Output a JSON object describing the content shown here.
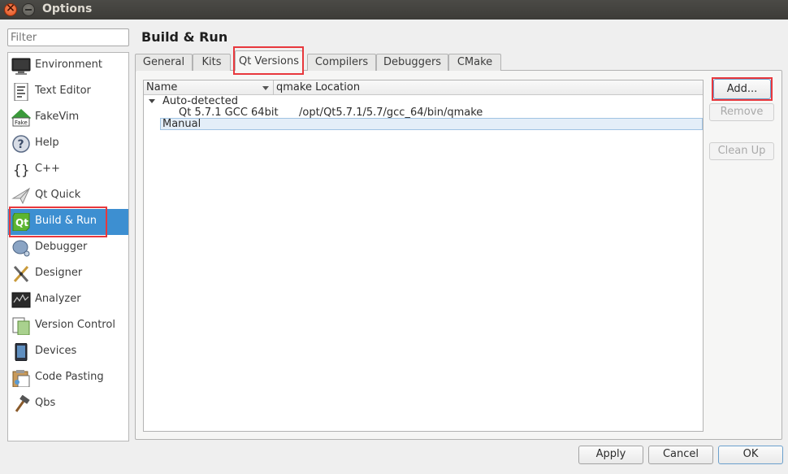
{
  "window": {
    "title": "Options"
  },
  "filter": {
    "placeholder": "Filter"
  },
  "categories": [
    {
      "label": "Environment",
      "icon": "monitor-icon"
    },
    {
      "label": "Text Editor",
      "icon": "text-editor-icon"
    },
    {
      "label": "FakeVim",
      "icon": "fakevim-icon"
    },
    {
      "label": "Help",
      "icon": "help-icon"
    },
    {
      "label": "C++",
      "icon": "braces-icon"
    },
    {
      "label": "Qt Quick",
      "icon": "qt-quick-icon"
    },
    {
      "label": "Build & Run",
      "icon": "qt-logo-icon",
      "selected": true
    },
    {
      "label": "Debugger",
      "icon": "bug-icon"
    },
    {
      "label": "Designer",
      "icon": "designer-icon"
    },
    {
      "label": "Analyzer",
      "icon": "analyzer-icon"
    },
    {
      "label": "Version Control",
      "icon": "version-control-icon"
    },
    {
      "label": "Devices",
      "icon": "device-icon"
    },
    {
      "label": "Code Pasting",
      "icon": "code-pasting-icon"
    },
    {
      "label": "Qbs",
      "icon": "hammer-icon"
    }
  ],
  "page": {
    "title": "Build & Run"
  },
  "tabs": [
    {
      "label": "General"
    },
    {
      "label": "Kits"
    },
    {
      "label": "Qt Versions",
      "active": true
    },
    {
      "label": "Compilers"
    },
    {
      "label": "Debuggers"
    },
    {
      "label": "CMake"
    }
  ],
  "tree": {
    "columns": [
      "Name",
      "qmake Location"
    ],
    "groups": [
      {
        "label": "Auto-detected",
        "items": [
          {
            "name": "Qt 5.7.1 GCC 64bit",
            "location": "/opt/Qt5.7.1/5.7/gcc_64/bin/qmake"
          }
        ]
      },
      {
        "label": "Manual",
        "items": []
      }
    ]
  },
  "side_buttons": {
    "add": "Add...",
    "remove": "Remove",
    "clean_up": "Clean Up"
  },
  "dialog_buttons": {
    "apply": "Apply",
    "cancel": "Cancel",
    "ok": "OK"
  },
  "colors": {
    "selection": "#3d8fd1",
    "highlight_box": "#e8383d"
  }
}
